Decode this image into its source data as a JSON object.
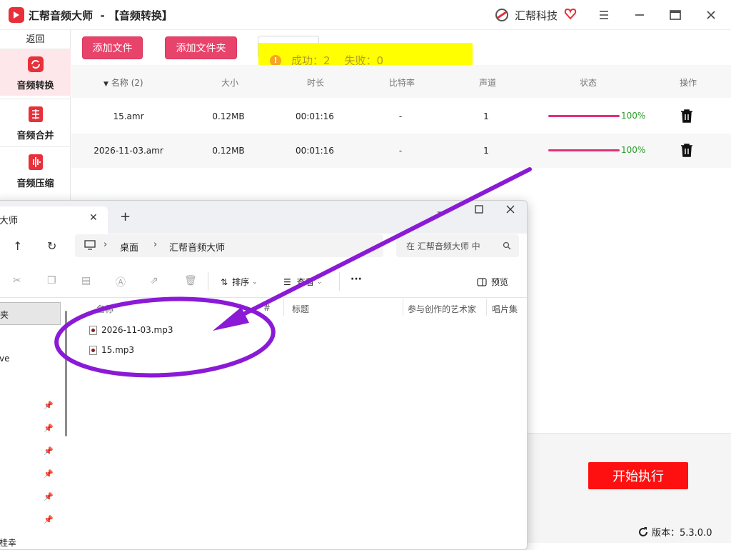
{
  "app": {
    "title": "汇帮音频大师  - 【音频转换】",
    "company": "汇帮科技"
  },
  "sidebar": {
    "back_label": "返回",
    "items": [
      {
        "label": "音频转换",
        "icon": "audio-convert-icon",
        "active": true
      },
      {
        "label": "音频合并",
        "icon": "audio-merge-icon",
        "active": false
      },
      {
        "label": "音频压缩",
        "icon": "audio-compress-icon",
        "active": false
      }
    ]
  },
  "toolbar": {
    "add_file": "添加文件",
    "add_folder": "添加文件夹"
  },
  "toast": {
    "success_label": "成功：2",
    "fail_label": "失败：0"
  },
  "table": {
    "headers": [
      "名称 (2)",
      "大小",
      "时长",
      "比特率",
      "声道",
      "状态",
      "操作"
    ],
    "rows": [
      {
        "name": "15.amr",
        "size": "0.12MB",
        "duration": "00:01:16",
        "bitrate": "-",
        "channels": "1",
        "progress": 1.0,
        "progress_label": "100%"
      },
      {
        "name": "2026-11-03.amr",
        "size": "0.12MB",
        "duration": "00:01:16",
        "bitrate": "-",
        "channels": "1",
        "progress": 1.0,
        "progress_label": "100%"
      }
    ]
  },
  "actions": {
    "start": "开始执行",
    "version": "版本：5.3.0.0"
  },
  "explorer": {
    "tab_title": "大师",
    "breadcrumb": [
      "桌面",
      "汇帮音频大师"
    ],
    "search_placeholder": "在 汇帮音频大师 中",
    "sort_label": "排序",
    "view_label": "查看",
    "more_label": "···",
    "preview_label": "预览",
    "columns": [
      "名称",
      "#",
      "标题",
      "参与创作的艺术家",
      "唱片集"
    ],
    "files": [
      "2026-11-03.mp3",
      "15.mp3"
    ],
    "nav_items": [
      "夹",
      "ve",
      "桂幸"
    ]
  },
  "colors": {
    "accent": "#e8436a",
    "progress": "#e0307a",
    "start": "#ff1010",
    "toast": "#ffff00",
    "annotation": "#8a1ad6"
  }
}
